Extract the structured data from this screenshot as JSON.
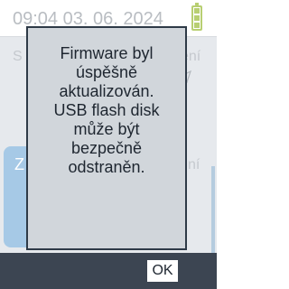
{
  "status_bar": {
    "datetime": "09:04 03. 06. 2024",
    "battery_level": 1.0,
    "battery_color": "#b8cf72"
  },
  "background": {
    "left_tile_label_fragment": "S",
    "right_tile_label_fragment": "ení",
    "blue_tile_letter": "Z",
    "right_lower_label_fragment": "ní",
    "blue_tile_icon": "usb-stick-icon",
    "right_tile_icon": "usb-port-icon",
    "accent_color": "#a6c9e6"
  },
  "dialog": {
    "message_lines": [
      "Firmware byl",
      "úspěšně",
      "aktualizován.",
      "USB flash disk",
      "může být",
      "bezpečně",
      "odstraněn."
    ]
  },
  "actions": {
    "ok_label": "OK"
  }
}
